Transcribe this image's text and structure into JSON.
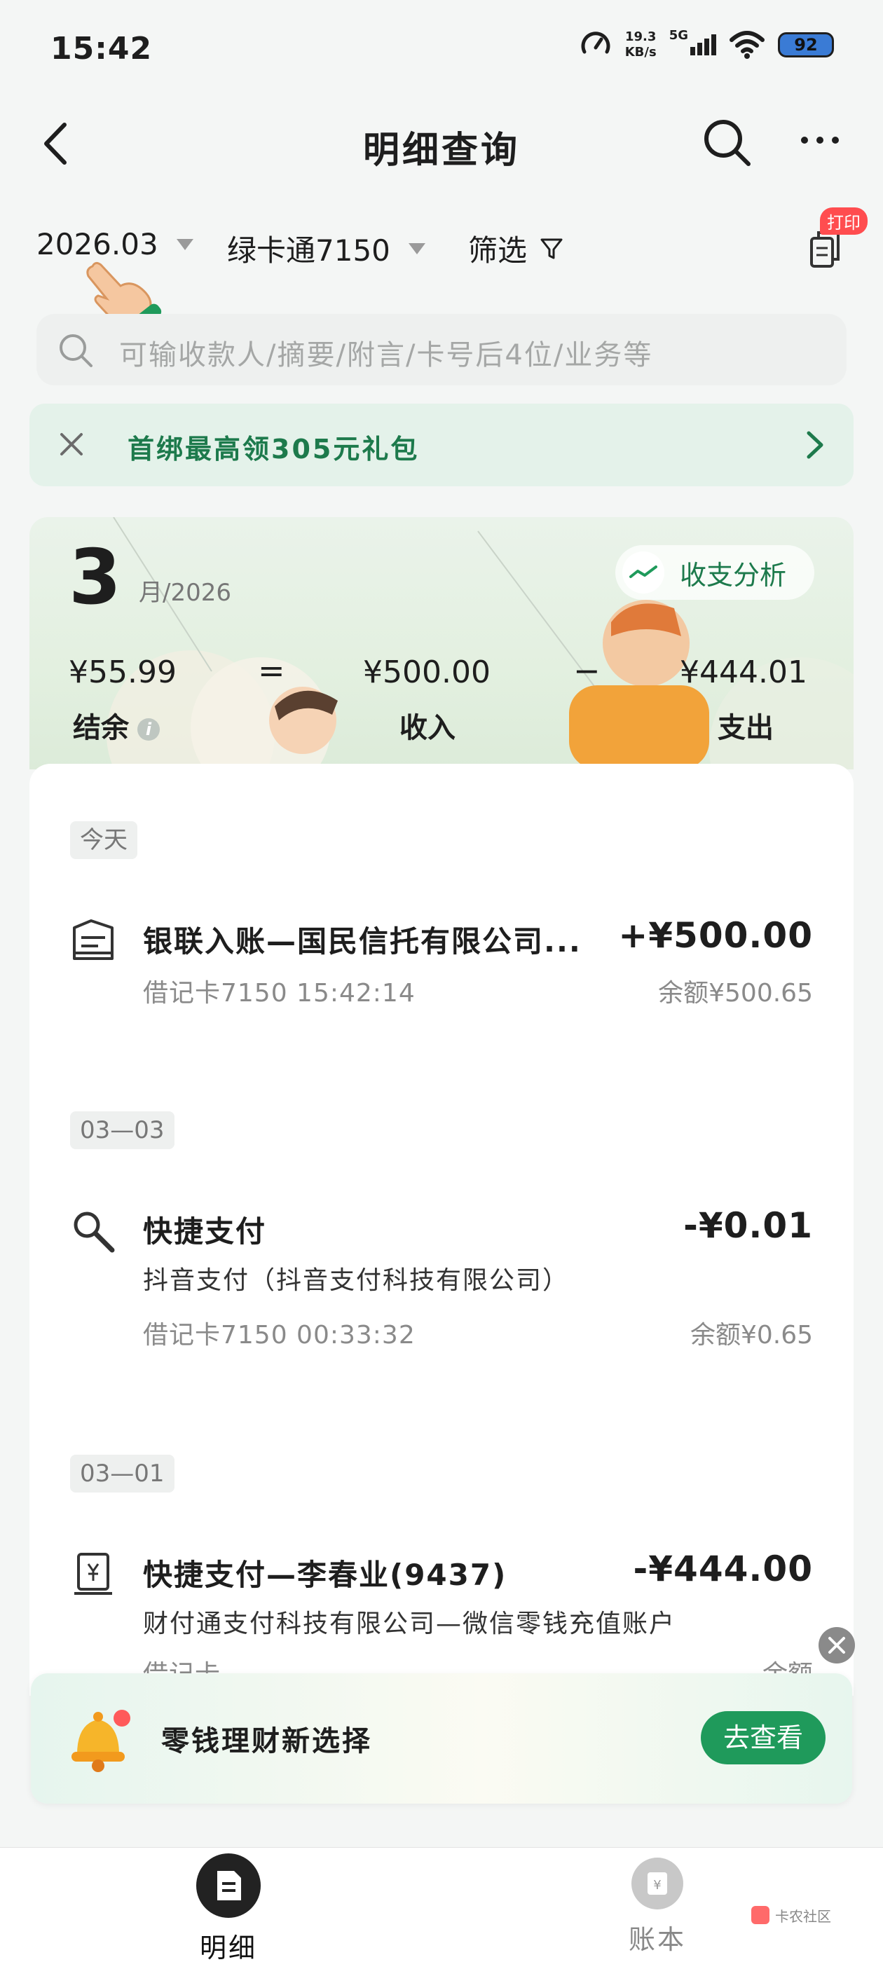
{
  "status_bar": {
    "time": "15:42",
    "speed_value": "19.3",
    "speed_unit": "KB/s",
    "network": "5G",
    "battery": "92"
  },
  "header": {
    "title": "明细查询",
    "icons": [
      "back-arrow-icon",
      "search-icon",
      "more-icon"
    ]
  },
  "filters": {
    "month": "2026.03",
    "card": "绿卡通7150",
    "filter_label": "筛选",
    "print_badge": "打印"
  },
  "search": {
    "placeholder": "可输收款人/摘要/附言/卡号后4位/业务等"
  },
  "promo_banner": {
    "text": "首绑最高领305元礼包"
  },
  "summary": {
    "month": "3",
    "year_suffix": "月/2026",
    "analysis_label": "收支分析",
    "balance_amount": "¥55.99",
    "balance_label": "结余",
    "equals": "=",
    "income_amount": "¥500.00",
    "income_label": "收入",
    "minus": "−",
    "expense_amount": "¥444.01",
    "expense_label": "支出"
  },
  "transactions": [
    {
      "date_label": "今天",
      "name": "银联入账—国民信托有限公司...",
      "amount": "+¥500.00",
      "subtitle": "",
      "meta": "借记卡7150 15:42:14",
      "balance": "余额¥500.65",
      "icon": "receipt-icon"
    },
    {
      "date_label": "03—03",
      "name": "快捷支付",
      "amount": "-¥0.01",
      "subtitle": "抖音支付（抖音支付科技有限公司）",
      "meta": "借记卡7150 00:33:32",
      "balance": "余额¥0.65",
      "icon": "quick-pay-icon"
    },
    {
      "date_label": "03—01",
      "name": "快捷支付—李春业(9437)",
      "amount": "-¥444.00",
      "subtitle": "财付通支付科技有限公司—微信零钱充值账户",
      "meta": "借记卡",
      "balance": "余额",
      "icon": "payment-device-icon"
    }
  ],
  "bottom_promo": {
    "text": "零钱理财新选择",
    "button": "去查看"
  },
  "tabbar": {
    "tabs": [
      {
        "label": "明细",
        "active": true
      },
      {
        "label": "账本",
        "active": false
      }
    ]
  },
  "watermark": "卡农社区",
  "colors": {
    "accent_green": "#1d7a4c",
    "button_green": "#1f9a5b",
    "badge_red": "#ff4d4f"
  }
}
